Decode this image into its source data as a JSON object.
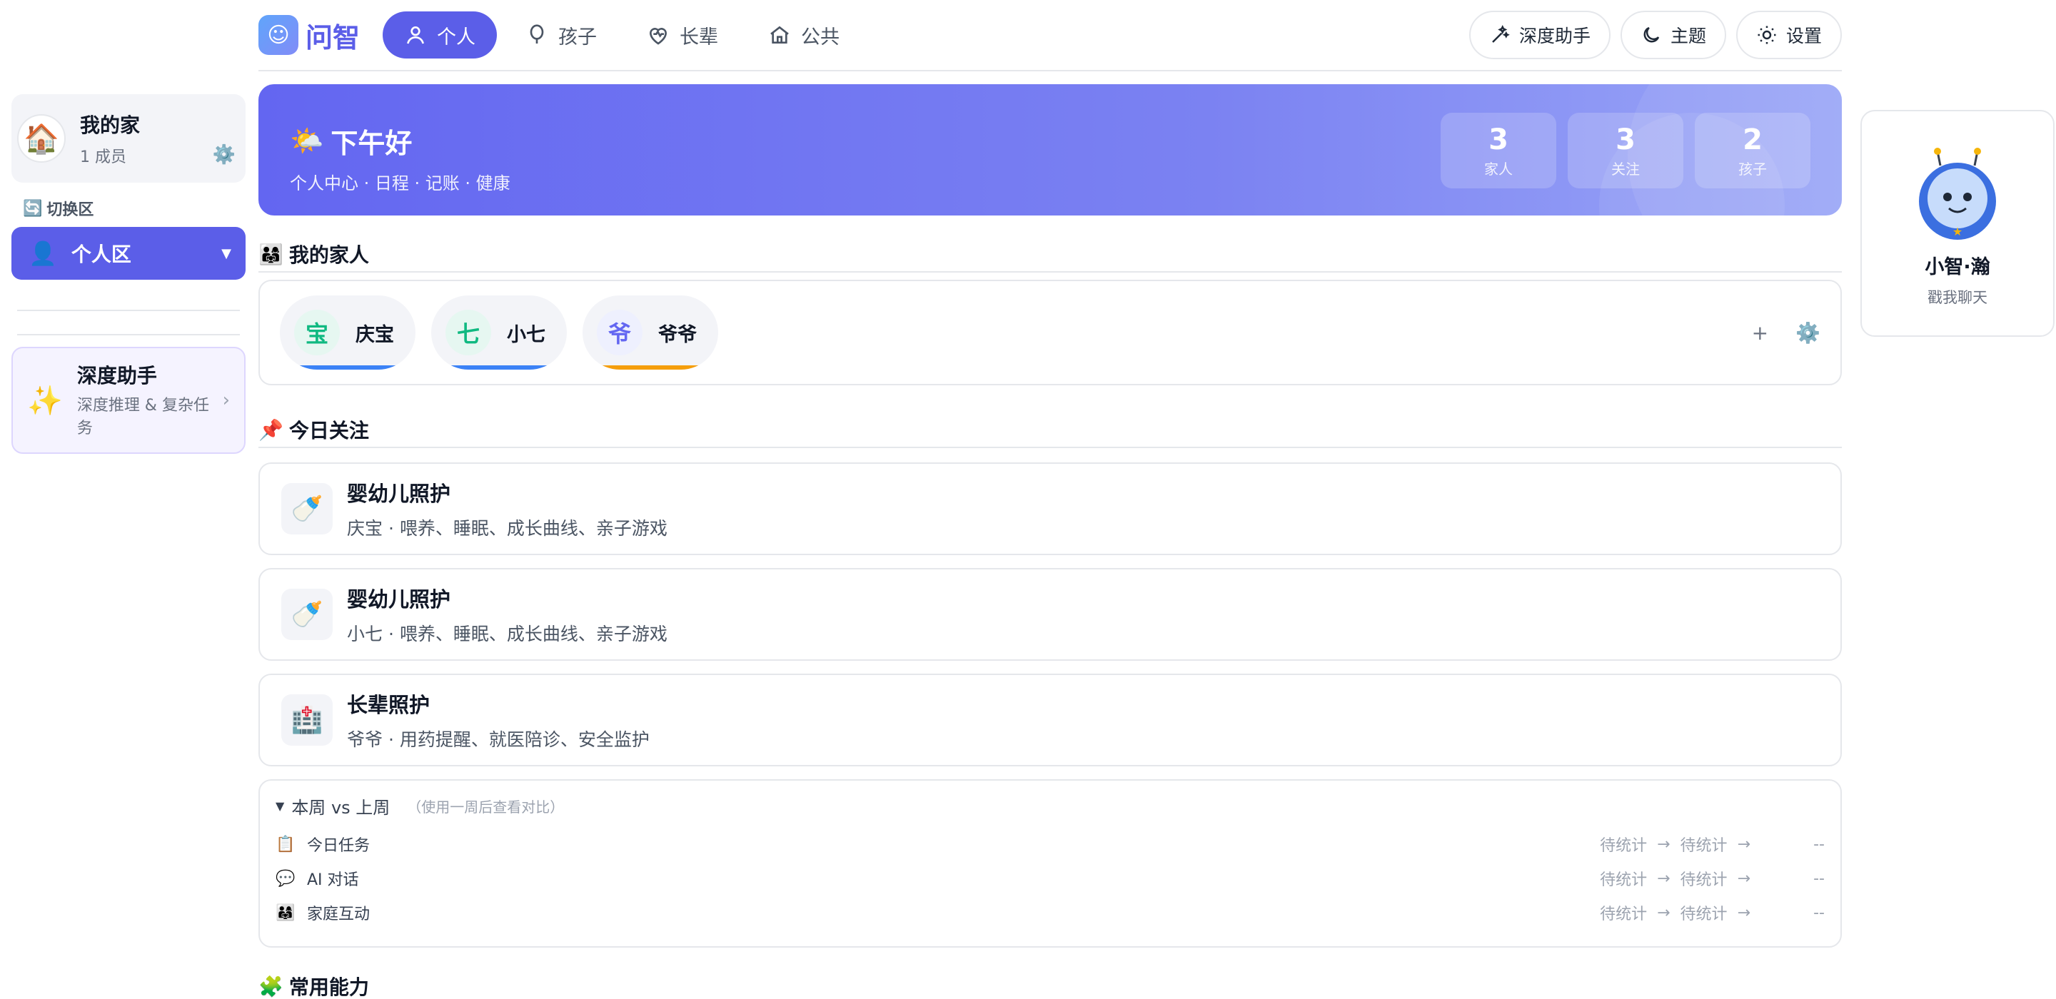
{
  "app": {
    "logo_text": "问智"
  },
  "nav": {
    "tabs": [
      {
        "label": "个人",
        "active": true
      },
      {
        "label": "孩子"
      },
      {
        "label": "长辈"
      },
      {
        "label": "公共"
      }
    ],
    "buttons": {
      "deep": "深度助手",
      "theme": "主题",
      "settings": "设置"
    }
  },
  "sidebar": {
    "home": {
      "name": "我的家",
      "members": "1 成员"
    },
    "switch_label": "切换区",
    "zone": "个人区",
    "deep": {
      "title": "深度助手",
      "subtitle": "深度推理 & 复杂任务"
    }
  },
  "hero": {
    "greeting": "下午好",
    "subtitle": "个人中心 · 日程 · 记账 · 健康",
    "stats": [
      {
        "num": "3",
        "label": "家人"
      },
      {
        "num": "3",
        "label": "关注"
      },
      {
        "num": "2",
        "label": "孩子"
      }
    ]
  },
  "family": {
    "title": "我的家人",
    "members": [
      {
        "avatar": "宝",
        "name": "庆宝"
      },
      {
        "avatar": "七",
        "name": "小七"
      },
      {
        "avatar": "爷",
        "name": "爷爷"
      }
    ],
    "add": "+"
  },
  "focus": {
    "title": "今日关注",
    "items": [
      {
        "title": "婴幼儿照护",
        "subtitle": "庆宝 · 喂养、睡眠、成长曲线、亲子游戏"
      },
      {
        "title": "婴幼儿照护",
        "subtitle": "小七 · 喂养、睡眠、成长曲线、亲子游戏"
      },
      {
        "title": "长辈照护",
        "subtitle": "爷爷 · 用药提醒、就医陪诊、安全监护"
      }
    ]
  },
  "compare": {
    "title": "本周 vs 上周",
    "hint": "（使用一周后查看对比）",
    "rows": [
      {
        "label": "今日任务",
        "a": "待统计",
        "b": "待统计",
        "delta": "--"
      },
      {
        "label": "AI 对话",
        "a": "待统计",
        "b": "待统计",
        "delta": "--"
      },
      {
        "label": "家庭互动",
        "a": "待统计",
        "b": "待统计",
        "delta": "--"
      }
    ]
  },
  "bottom_section": {
    "title": "常用能力"
  },
  "assistant": {
    "name": "小智·瀚",
    "subtitle": "戳我聊天"
  },
  "colors": {
    "accent": "#5b5ee8",
    "blue_bar": "#3b82f6",
    "orange_bar": "#f59e0b"
  }
}
